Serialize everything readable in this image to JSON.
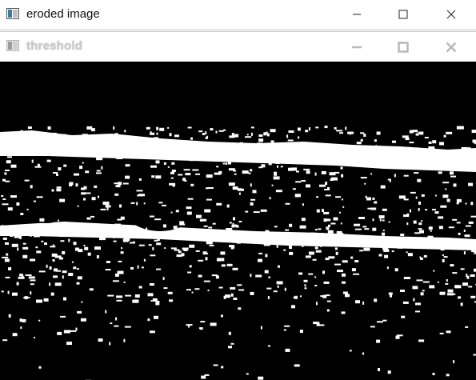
{
  "outer_window": {
    "title": "eroded image",
    "controls": [
      "minimize-icon",
      "maximize-icon",
      "close-icon"
    ]
  },
  "inner_window": {
    "title": "threshold",
    "controls": [
      "minimize-icon",
      "maximize-icon",
      "close-icon"
    ]
  },
  "colors": {
    "image_foreground": "#ffffff",
    "image_background": "#000000",
    "inactive_title": "#c8c8c8",
    "inactive_icon": "#b9b9b9",
    "active_icon": "#222222"
  }
}
